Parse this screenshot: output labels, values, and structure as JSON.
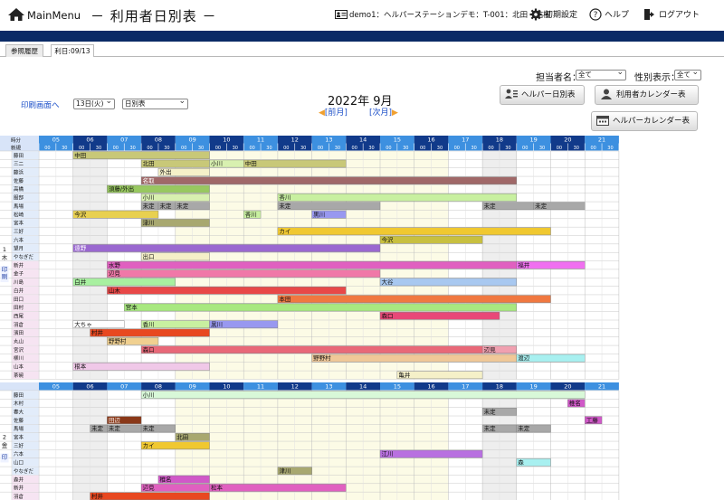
{
  "header": {
    "menu_label": "MainMenu",
    "page_title": "－ 利用者日別表 －",
    "user_text": "demo1：ヘルパーステーションデモ：T-001：北田　祐樹",
    "settings_label": "初期設定",
    "help_label": "ヘルプ",
    "logout_label": "ログアウト"
  },
  "tabs": [
    {
      "label": "参照履歴"
    },
    {
      "label": "利日:09/13"
    }
  ],
  "controls": {
    "staff_label": "担当者名：",
    "staff_value": "全て",
    "gender_label": "性別表示：",
    "gender_value": "全て",
    "print_link": "印刷画面へ",
    "day_value": "13日(火)",
    "view_value": "日別表",
    "month_title": "2022年 9月",
    "prev_label": "[前月]",
    "next_label": "[次月]",
    "helper_day_btn": "ヘルパー日別表",
    "user_cal_btn": "利用者カレンダー表",
    "helper_cal_btn": "ヘルパーカレンダー表"
  },
  "colors": {
    "header_navy": "#0a2a66",
    "hour_dark": "#113a8a",
    "hour_light": "#3d90e0",
    "link_blue": "#1a4ec8"
  },
  "grid": {
    "hours": [
      "05",
      "06",
      "07",
      "08",
      "09",
      "10",
      "11",
      "12",
      "13",
      "14",
      "15",
      "16",
      "17",
      "18",
      "19",
      "20",
      "21"
    ],
    "half": [
      "00",
      "30"
    ],
    "corner1": "時分",
    "corner2": "新規",
    "sections": [
      {
        "day_label": "1 木",
        "print_label": "印刷",
        "rows": [
          {
            "name": "藤田",
            "bars": [
              {
                "s": 6,
                "e": 10,
                "c": "#c8c878",
                "t": "中田"
              }
            ]
          },
          {
            "name": "三二",
            "bars": [
              {
                "s": 8,
                "e": 10,
                "c": "#c8c878",
                "t": "北田"
              },
              {
                "s": 10,
                "e": 11,
                "c": "#d8f0b0",
                "t": "小川"
              },
              {
                "s": 11,
                "e": 14,
                "c": "#c8c878",
                "t": "中田"
              }
            ]
          },
          {
            "name": "藤浜",
            "bars": [
              {
                "s": 8.5,
                "e": 10,
                "c": "#f5f0c8",
                "t": "外出"
              }
            ]
          },
          {
            "name": "佐藤",
            "bars": [
              {
                "s": 8,
                "e": 19,
                "c": "#a06868",
                "t": "名取"
              }
            ]
          },
          {
            "name": "高橋",
            "bars": [
              {
                "s": 7,
                "e": 10,
                "c": "#98c860",
                "t": "須藤/外出"
              }
            ]
          },
          {
            "name": "服部",
            "bars": [
              {
                "s": 8,
                "e": 10,
                "c": "#d8f0b0",
                "t": "小川"
              },
              {
                "s": 12,
                "e": 19,
                "c": "#c8f0a0",
                "t": "香川"
              }
            ]
          },
          {
            "name": "馬場",
            "bars": [
              {
                "s": 8,
                "e": 8.5,
                "c": "#a8a8a8",
                "t": "未定"
              },
              {
                "s": 8.5,
                "e": 9,
                "c": "#a8a8a8",
                "t": "未定"
              },
              {
                "s": 9,
                "e": 10,
                "c": "#a8a8a8",
                "t": "未定"
              },
              {
                "s": 12,
                "e": 15,
                "c": "#a8a8a8",
                "t": "未定"
              },
              {
                "s": 18,
                "e": 19.5,
                "c": "#a8a8a8",
                "t": "未定"
              },
              {
                "s": 19.5,
                "e": 21,
                "c": "#a8a8a8",
                "t": "未定"
              }
            ]
          },
          {
            "name": "松崎",
            "bars": [
              {
                "s": 6,
                "e": 8.5,
                "c": "#e8d050",
                "t": "今沢"
              },
              {
                "s": 11,
                "e": 11.5,
                "c": "#c8f0a0",
                "t": "香川"
              },
              {
                "s": 13,
                "e": 14,
                "c": "#9898f0",
                "t": "黒川"
              }
            ]
          },
          {
            "name": "宮本",
            "bars": [
              {
                "s": 8,
                "e": 10,
                "c": "#a8a870",
                "t": "津川"
              }
            ]
          },
          {
            "name": "三好",
            "bars": [
              {
                "s": 12,
                "e": 20,
                "c": "#f0c830",
                "t": "カイ"
              }
            ]
          },
          {
            "name": "六本",
            "bars": [
              {
                "s": 15,
                "e": 18,
                "c": "#c8c040",
                "t": "今沢"
              }
            ]
          },
          {
            "name": "望月",
            "bars": [
              {
                "s": 6,
                "e": 15,
                "c": "#9a68d0",
                "t": "遠野"
              }
            ]
          },
          {
            "name": "やなぎだ",
            "bars": [
              {
                "s": 8,
                "e": 10,
                "c": "#f5f0c8",
                "t": "出口"
              }
            ]
          },
          {
            "name": "新井",
            "bars": [
              {
                "s": 7,
                "e": 21,
                "c": "#e060c0",
                "t": "水野"
              },
              {
                "s": 19,
                "e": 21,
                "c": "#f070f0",
                "t": "福井"
              }
            ]
          },
          {
            "name": "金子",
            "bars": [
              {
                "s": 7,
                "e": 15,
                "c": "#f078a8",
                "t": "辺見"
              }
            ]
          },
          {
            "name": "川島",
            "bars": [
              {
                "s": 6,
                "e": 9,
                "c": "#a8f0a0",
                "t": "白井"
              },
              {
                "s": 15,
                "e": 19,
                "c": "#a8c8f0",
                "t": "大谷"
              }
            ]
          },
          {
            "name": "白井",
            "bars": [
              {
                "s": 7,
                "e": 14,
                "c": "#e84848",
                "t": "山木"
              }
            ]
          },
          {
            "name": "田口",
            "bars": [
              {
                "s": 12,
                "e": 20,
                "c": "#f07840",
                "t": "本田"
              }
            ]
          },
          {
            "name": "田村",
            "bars": [
              {
                "s": 7.5,
                "e": 19,
                "c": "#a8e880",
                "t": "宮本"
              }
            ]
          },
          {
            "name": "西尾",
            "bars": [
              {
                "s": 15,
                "e": 18.5,
                "c": "#e84878",
                "t": "森口"
              }
            ]
          },
          {
            "name": "羽倉",
            "bars": [
              {
                "s": 6,
                "e": 7.5,
                "c": "#ffffff",
                "t": "大ちゃ"
              },
              {
                "s": 8,
                "e": 10,
                "c": "#c8f0a0",
                "t": "香川"
              },
              {
                "s": 10,
                "e": 12,
                "c": "#9898f0",
                "t": "黒川"
              }
            ]
          },
          {
            "name": "濱田",
            "bars": [
              {
                "s": 6.5,
                "e": 10,
                "c": "#e84820",
                "t": "村井"
              }
            ]
          },
          {
            "name": "丸山",
            "bars": [
              {
                "s": 7,
                "e": 8.5,
                "c": "#f0d090",
                "t": "野野村"
              }
            ]
          },
          {
            "name": "宮沢",
            "bars": [
              {
                "s": 8,
                "e": 19,
                "c": "#e86878",
                "t": "森口"
              },
              {
                "s": 18,
                "e": 19,
                "c": "#f0a0b0",
                "t": "辺見"
              }
            ]
          },
          {
            "name": "柳川",
            "bars": [
              {
                "s": 13,
                "e": 19,
                "c": "#f0c898",
                "t": "野野村"
              },
              {
                "s": 19,
                "e": 21,
                "c": "#a8f0f0",
                "t": "渡辺"
              }
            ]
          },
          {
            "name": "山本",
            "bars": [
              {
                "s": 6,
                "e": 10,
                "c": "#f0c8e8",
                "t": "根本"
              }
            ]
          },
          {
            "name": "茶碗",
            "bars": [
              {
                "s": 15.5,
                "e": 18,
                "c": "#f5f0c8",
                "t": "亀井"
              }
            ]
          }
        ]
      },
      {
        "day_label": "2 金",
        "print_label": "印",
        "rows": [
          {
            "name": "藤田",
            "bars": [
              {
                "s": 8,
                "e": 21,
                "c": "#d8f8d8",
                "t": "小川"
              }
            ]
          },
          {
            "name": "木村",
            "bars": [
              {
                "s": 20.5,
                "e": 21,
                "c": "#d058c8",
                "t": "椎名"
              }
            ]
          },
          {
            "name": "春大",
            "bars": [
              {
                "s": 18,
                "e": 19,
                "c": "#a8a8a8",
                "t": "未定"
              }
            ]
          },
          {
            "name": "佐藤",
            "bars": [
              {
                "s": 7,
                "e": 8,
                "c": "#8a3818",
                "t": "田辺"
              },
              {
                "s": 21,
                "e": 21.5,
                "c": "#d058c8",
                "t": "工藤"
              }
            ]
          },
          {
            "name": "馬場",
            "bars": [
              {
                "s": 6.5,
                "e": 7,
                "c": "#a8a8a8",
                "t": "未定"
              },
              {
                "s": 7,
                "e": 8,
                "c": "#a8a8a8",
                "t": "未定"
              },
              {
                "s": 8,
                "e": 9,
                "c": "#a8a8a8",
                "t": "未定"
              },
              {
                "s": 18,
                "e": 19,
                "c": "#a8a8a8",
                "t": "未定"
              },
              {
                "s": 19,
                "e": 20,
                "c": "#a8a8a8",
                "t": "未定"
              }
            ]
          },
          {
            "name": "宮本",
            "bars": [
              {
                "s": 9,
                "e": 10,
                "c": "#a8a870",
                "t": "北田"
              }
            ]
          },
          {
            "name": "三好",
            "bars": [
              {
                "s": 8,
                "e": 10,
                "c": "#f0c830",
                "t": "カイ"
              }
            ]
          },
          {
            "name": "六本",
            "bars": [
              {
                "s": 15,
                "e": 18,
                "c": "#b870e0",
                "t": "江川"
              }
            ]
          },
          {
            "name": "山口",
            "bars": [
              {
                "s": 19,
                "e": 20,
                "c": "#a8f0f0",
                "t": "森"
              }
            ]
          },
          {
            "name": "やなぎだ",
            "bars": [
              {
                "s": 12,
                "e": 13,
                "c": "#a8a870",
                "t": "津川"
              }
            ]
          },
          {
            "name": "森井",
            "bars": [
              {
                "s": 8.5,
                "e": 10,
                "c": "#d058c8",
                "t": "椎名"
              }
            ]
          },
          {
            "name": "新井",
            "bars": [
              {
                "s": 8,
                "e": 10,
                "c": "#e060c0",
                "t": "辺見"
              },
              {
                "s": 10,
                "e": 14,
                "c": "#e060c0",
                "t": "松本"
              }
            ]
          },
          {
            "name": "羽倉",
            "bars": [
              {
                "s": 6.5,
                "e": 10,
                "c": "#e84820",
                "t": "村井"
              }
            ]
          }
        ]
      }
    ]
  }
}
